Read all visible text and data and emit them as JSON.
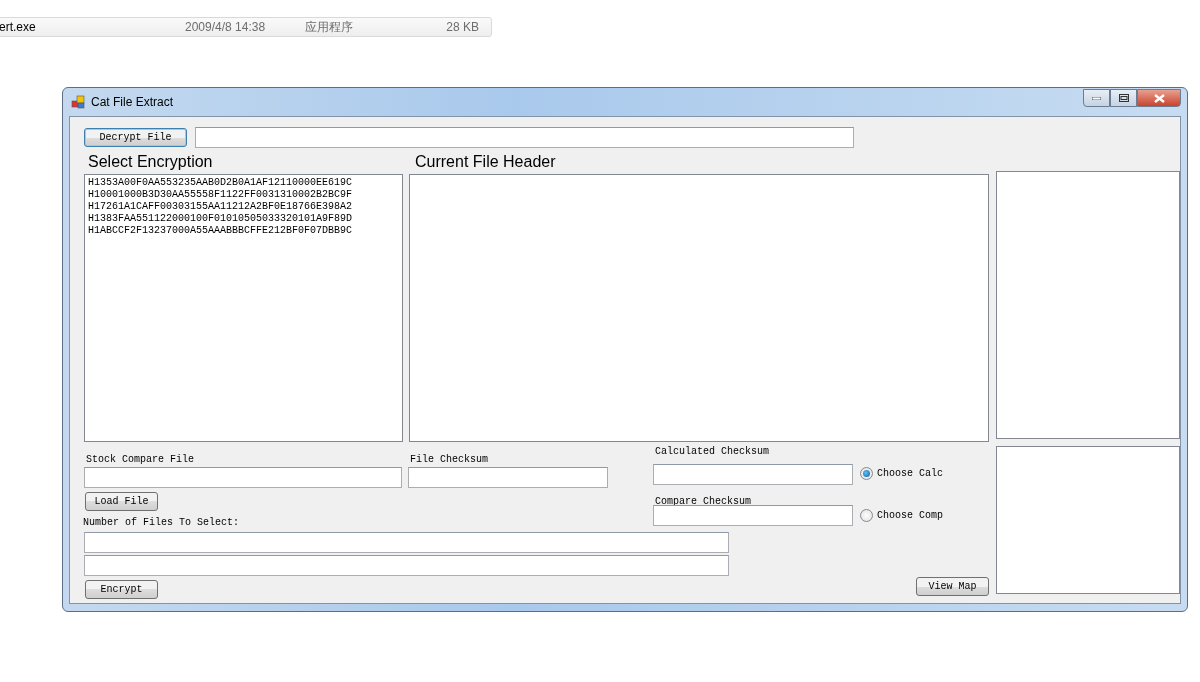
{
  "explorer_row": {
    "name": "ert.exe",
    "modified": "2009/4/8 14:38",
    "type": "应用程序",
    "size": "28 KB"
  },
  "window": {
    "title": "Cat File Extract"
  },
  "decrypt": {
    "button": "Decrypt File"
  },
  "select_encryption": {
    "label": "Select Encryption",
    "items": [
      {
        "text": "H1353A00F0AA553235AAB0D2B0A1AF12110000EE619C",
        "selected": false
      },
      {
        "text": "H10001000B3D30AA55558F1122FF0031310002B2BC9F",
        "selected": false
      },
      {
        "text": "H17261A1CAFF00303155AA11212A2BF0E18766E398A2",
        "selected": false
      },
      {
        "text": "H1383FAA551122000100F01010505033320101A9F89D",
        "selected": false
      },
      {
        "text": "H1ABCCF2F13237000A55AAABBBCFFE212BF0F07DBB9C",
        "selected": false
      }
    ]
  },
  "current_file_header": {
    "label": "Current File Header"
  },
  "stock_compare_file": {
    "label": "Stock Compare File",
    "button": "Load File"
  },
  "file_checksum": {
    "label": "File Checksum"
  },
  "calculated_checksum": {
    "label": "Calculated Checksum",
    "radio": "Choose Calc",
    "selected": true
  },
  "compare_checksum": {
    "label": "Compare Checksum",
    "radio": "Choose Comp",
    "selected": false
  },
  "number_of_files": {
    "label": "Number of Files To Select:"
  },
  "buttons": {
    "encrypt": "Encrypt",
    "view_map": "View Map"
  }
}
